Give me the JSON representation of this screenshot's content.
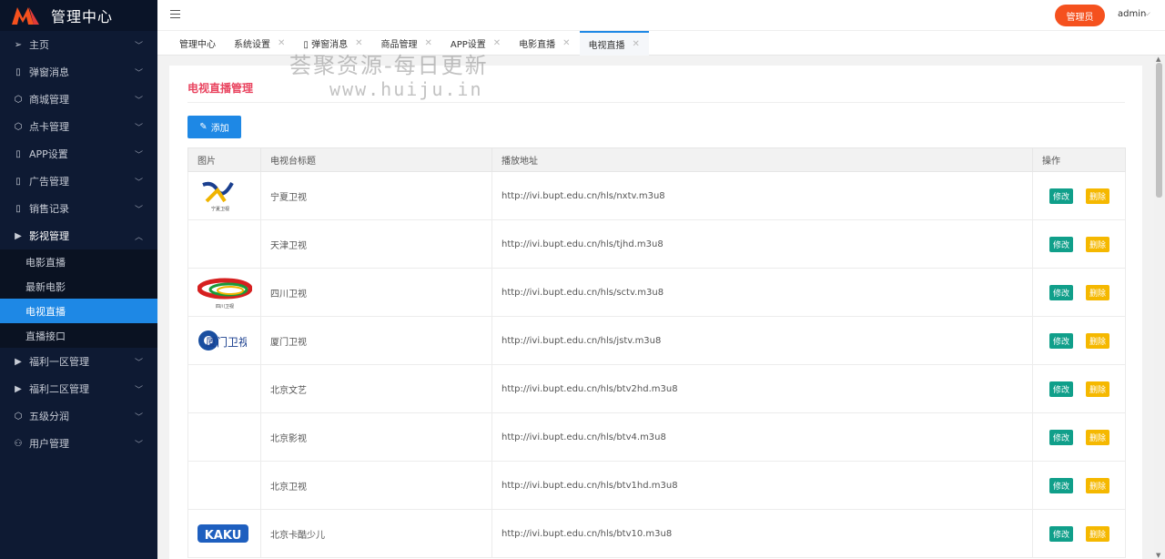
{
  "app": {
    "title": "管理中心",
    "brand_color": "#f5511e",
    "accent_color": "#1e88e5"
  },
  "sidebar": {
    "items": [
      {
        "label": "主页",
        "icon": "send-icon"
      },
      {
        "label": "弹窗消息",
        "icon": "mobile-icon"
      },
      {
        "label": "商城管理",
        "icon": "cube-icon"
      },
      {
        "label": "点卡管理",
        "icon": "cube-icon"
      },
      {
        "label": "APP设置",
        "icon": "mobile-icon"
      },
      {
        "label": "广告管理",
        "icon": "mobile-icon"
      },
      {
        "label": "销售记录",
        "icon": "mobile-icon"
      },
      {
        "label": "影视管理",
        "icon": "video-icon"
      }
    ],
    "sub_items": [
      "电影直播",
      "最新电影",
      "电视直播",
      "直播接口"
    ],
    "items_after": [
      {
        "label": "福利一区管理",
        "icon": "video-icon"
      },
      {
        "label": "福利二区管理",
        "icon": "video-icon"
      },
      {
        "label": "五级分润",
        "icon": "cube-icon"
      },
      {
        "label": "用户管理",
        "icon": "user-icon"
      }
    ]
  },
  "header": {
    "role": "管理员",
    "user": "admin"
  },
  "tabs": [
    {
      "label": "管理中心"
    },
    {
      "label": "系统设置"
    },
    {
      "label": "▯ 弹窗消息"
    },
    {
      "label": "商品管理"
    },
    {
      "label": "APP设置"
    },
    {
      "label": "电影直播"
    },
    {
      "label": "电视直播"
    }
  ],
  "page": {
    "title": "电视直播管理",
    "add_label": "添加"
  },
  "table": {
    "headers": [
      "图片",
      "电视台标题",
      "播放地址",
      "操作"
    ],
    "edit_label": "修改",
    "delete_label": "删除",
    "rows": [
      {
        "name": "宁夏卫视",
        "url": "http://ivi.bupt.edu.cn/hls/nxtv.m3u8",
        "logo": "ningxia",
        "logo_text": "宁夏卫视"
      },
      {
        "name": "天津卫视",
        "url": "http://ivi.bupt.edu.cn/hls/tjhd.m3u8",
        "logo": ""
      },
      {
        "name": "四川卫视",
        "url": "http://ivi.bupt.edu.cn/hls/sctv.m3u8",
        "logo": "sichuan",
        "logo_text": "四川卫视"
      },
      {
        "name": "厦门卫视",
        "url": "http://ivi.bupt.edu.cn/hls/jstv.m3u8",
        "logo": "xiamen",
        "logo_text": "厦门卫视"
      },
      {
        "name": "北京文艺",
        "url": "http://ivi.bupt.edu.cn/hls/btv2hd.m3u8",
        "logo": ""
      },
      {
        "name": "北京影视",
        "url": "http://ivi.bupt.edu.cn/hls/btv4.m3u8",
        "logo": ""
      },
      {
        "name": "北京卫视",
        "url": "http://ivi.bupt.edu.cn/hls/btv1hd.m3u8",
        "logo": ""
      },
      {
        "name": "北京卡酷少儿",
        "url": "http://ivi.bupt.edu.cn/hls/btv10.m3u8",
        "logo": "kaku",
        "logo_text": "KAKU"
      }
    ]
  },
  "watermark": {
    "line1": "荟聚资源-每日更新",
    "line2": "www.huiju.in"
  }
}
